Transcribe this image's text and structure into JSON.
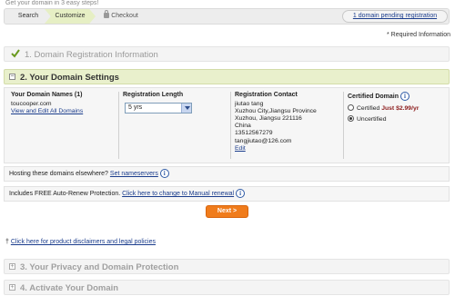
{
  "tagline": "Get your domain in 3 easy steps!",
  "steps": {
    "search": "Search",
    "customize": "Customize",
    "checkout": "Checkout",
    "active": "Customize"
  },
  "pending_link": "1 domain pending registration",
  "required_note": "* Required Information",
  "sections": {
    "s1": "1. Domain Registration Information",
    "s2": "2. Your Domain Settings",
    "s3": "3. Your Privacy and Domain Protection",
    "s4": "4. Activate Your Domain"
  },
  "settings": {
    "names_header": "Your Domain Names (1)",
    "domain": "toucooper.com",
    "view_edit": "View and Edit All Domains",
    "length_header": "Registration Length",
    "length_value": "5 yrs",
    "contact_header": "Registration Contact",
    "contact_lines": [
      "jiutao tang",
      "Xuzhou City,Jiangsu Province",
      "Xuzhou, Jiangsu 221116",
      "China",
      "13512567279",
      "tangjiutao@126.com"
    ],
    "contact_edit": "Edit",
    "certified_header": "Certified Domain",
    "certified_label": "Certified",
    "certified_price": "Just $2.99/yr",
    "uncertified_label": "Uncertified",
    "selected": "Uncertified"
  },
  "hosting": {
    "text": "Hosting these domains elsewhere?",
    "link": "Set nameservers"
  },
  "autorenew": {
    "text": "Includes FREE Auto-Renew Protection.",
    "link": "Click here to change to Manual renewal"
  },
  "next_button": "Next >",
  "disclaimer": {
    "marker": "†",
    "link": "Click here for product disclaimers and legal policies"
  },
  "colors": {
    "accent_green": "#e9f0cc",
    "button_orange": "#f07c1c",
    "link_blue": "#1a3c8c",
    "price_red": "#8b1a1a"
  }
}
